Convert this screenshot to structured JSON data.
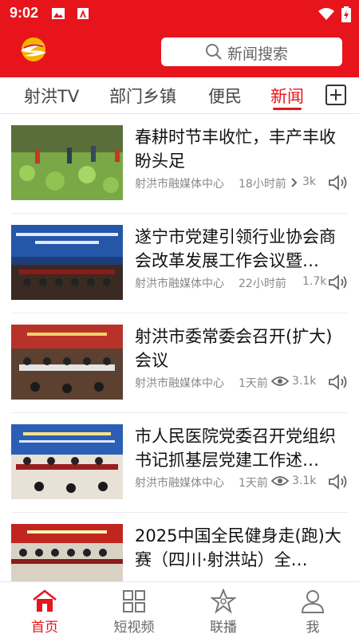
{
  "status_bar": {
    "time": "9:02"
  },
  "search": {
    "placeholder": "新闻搜索"
  },
  "tabs": [
    {
      "label": "射洪TV"
    },
    {
      "label": "部门乡镇"
    },
    {
      "label": "便民"
    },
    {
      "label": "新闻",
      "active": true
    }
  ],
  "news": [
    {
      "title": "春耕时节丰收忙，丰产丰收盼头足",
      "source": "射洪市融媒体中心",
      "time": "18小时前",
      "views": "3k"
    },
    {
      "title": "遂宁市党建引领行业协会商会改革发展工作会议暨…",
      "source": "射洪市融媒体中心",
      "time": "22小时前",
      "views": "1.7k"
    },
    {
      "title": "射洪市委常委会召开(扩大)会议",
      "source": "射洪市融媒体中心",
      "time": "1天前",
      "views": "3.1k"
    },
    {
      "title": "市人民医院党委召开党组织书记抓基层党建工作述…",
      "source": "射洪市融媒体中心",
      "time": "1天前",
      "views": "3.1k"
    },
    {
      "title": "2025中国全民健身走(跑)大赛（四川·射洪站）全…",
      "source": "",
      "time": "",
      "views": ""
    }
  ],
  "bottom_nav": [
    {
      "label": "首页",
      "icon": "home-icon",
      "active": true
    },
    {
      "label": "短视频",
      "icon": "grid-icon"
    },
    {
      "label": "联播",
      "icon": "broadcast-icon"
    },
    {
      "label": "我",
      "icon": "user-icon"
    }
  ],
  "colors": {
    "brand_red": "#e8141b",
    "text_gray": "#888888"
  }
}
